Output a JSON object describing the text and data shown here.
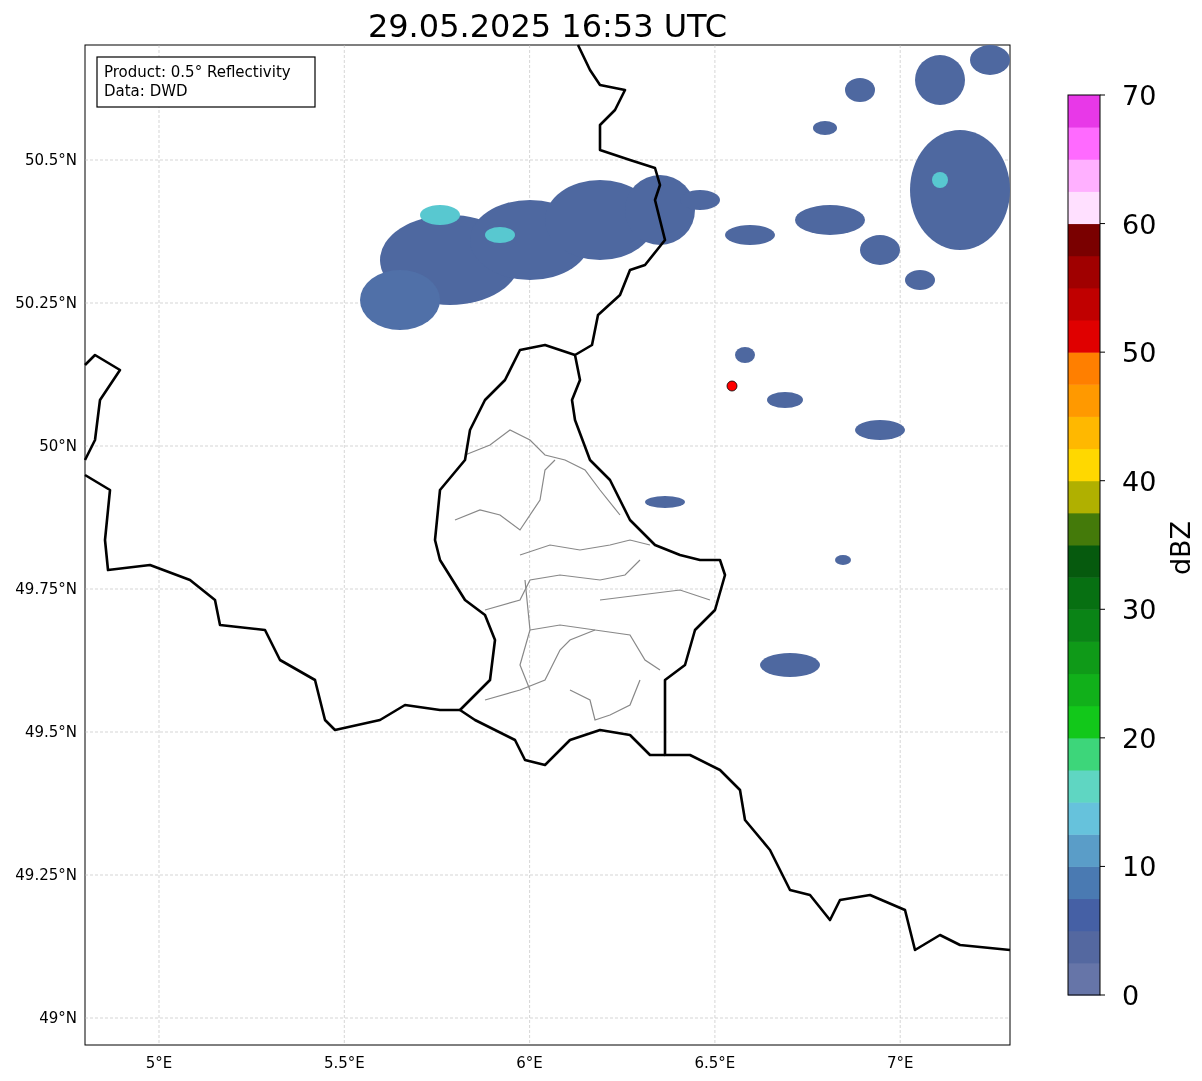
{
  "title": "29.05.2025 16:53 UTC",
  "info_box": [
    "Product: 0.5° Reflectivity",
    "Data: DWD"
  ],
  "map": {
    "y_ticks": [
      "50.5°N",
      "50.25°N",
      "50°N",
      "49.75°N",
      "49.5°N",
      "49.25°N",
      "49°N"
    ],
    "x_ticks": [
      "5°E",
      "5.5°E",
      "6°E",
      "6.5°E",
      "7°E"
    ]
  },
  "colorbar": {
    "label": "dBZ",
    "ticks": [
      "70",
      "60",
      "50",
      "40",
      "30",
      "20",
      "10",
      "0"
    ],
    "segments": [
      {
        "color": "#6675a8"
      },
      {
        "color": "#5468a0"
      },
      {
        "color": "#4560a5"
      },
      {
        "color": "#4a7ab2"
      },
      {
        "color": "#5a9dc8"
      },
      {
        "color": "#66c2dc"
      },
      {
        "color": "#5fd6c2"
      },
      {
        "color": "#3dd67a"
      },
      {
        "color": "#12c81a"
      },
      {
        "color": "#11b01a"
      },
      {
        "color": "#0f9a18"
      },
      {
        "color": "#0a8416"
      },
      {
        "color": "#077012"
      },
      {
        "color": "#065a0e"
      },
      {
        "color": "#447a0a"
      },
      {
        "color": "#b0b000"
      },
      {
        "color": "#ffd800"
      },
      {
        "color": "#ffb800"
      },
      {
        "color": "#ff9900"
      },
      {
        "color": "#ff7f00"
      },
      {
        "color": "#e00000"
      },
      {
        "color": "#c00000"
      },
      {
        "color": "#a00000"
      },
      {
        "color": "#7a0000"
      },
      {
        "color": "#ffe0ff"
      },
      {
        "color": "#ffb0ff"
      },
      {
        "color": "#ff6aff"
      },
      {
        "color": "#e838e8"
      }
    ]
  }
}
